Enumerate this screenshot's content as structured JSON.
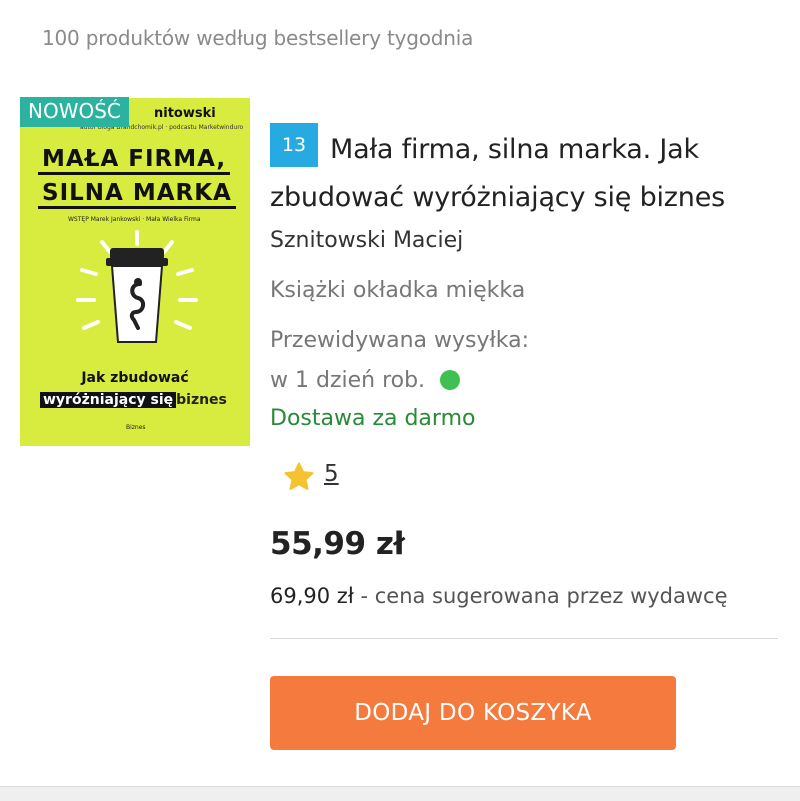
{
  "header": {
    "subtitle": "100 produktów według bestsellery tygodnia"
  },
  "product": {
    "badge": "NOWOŚĆ",
    "cover": {
      "author_fragment": "nitowski",
      "small_line": "autor bloga Brandchomik.pl · podcastu Marketwinduro",
      "title_line1": "MAŁA FIRMA,",
      "title_line2": "SILNA MARKA",
      "preface": "WSTĘP Marek Jankowski · Mała Wielka Firma",
      "tagline_line1": "Jak zbudować",
      "tagline_highlight": "wyróżniający się",
      "tagline_rest": "biznes",
      "publisher": "Biznes",
      "background_color": "#d8ec3f"
    },
    "rank": "13",
    "title_line1": "Mała firma, silna marka. Jak",
    "title_line2": "zbudować wyróżniający się biznes",
    "author": "Sznitowski Maciej",
    "format": "Książki okładka miękka",
    "shipping_label": "Przewidywana wysyłka:",
    "shipping_time": "w 1 dzień rob.",
    "shipping_status_color": "#3ec150",
    "delivery": "Dostawa za darmo",
    "rating_icon": "star-icon",
    "rating": "5",
    "price": "55,99 zł",
    "suggested_price": "69,90 zł",
    "suggested_text": " - cena sugerowana przez wydawcę",
    "add_to_cart": "DODAJ DO KOSZYKA",
    "accent_color": "#f47a3e",
    "rank_color": "#27a9e1"
  }
}
